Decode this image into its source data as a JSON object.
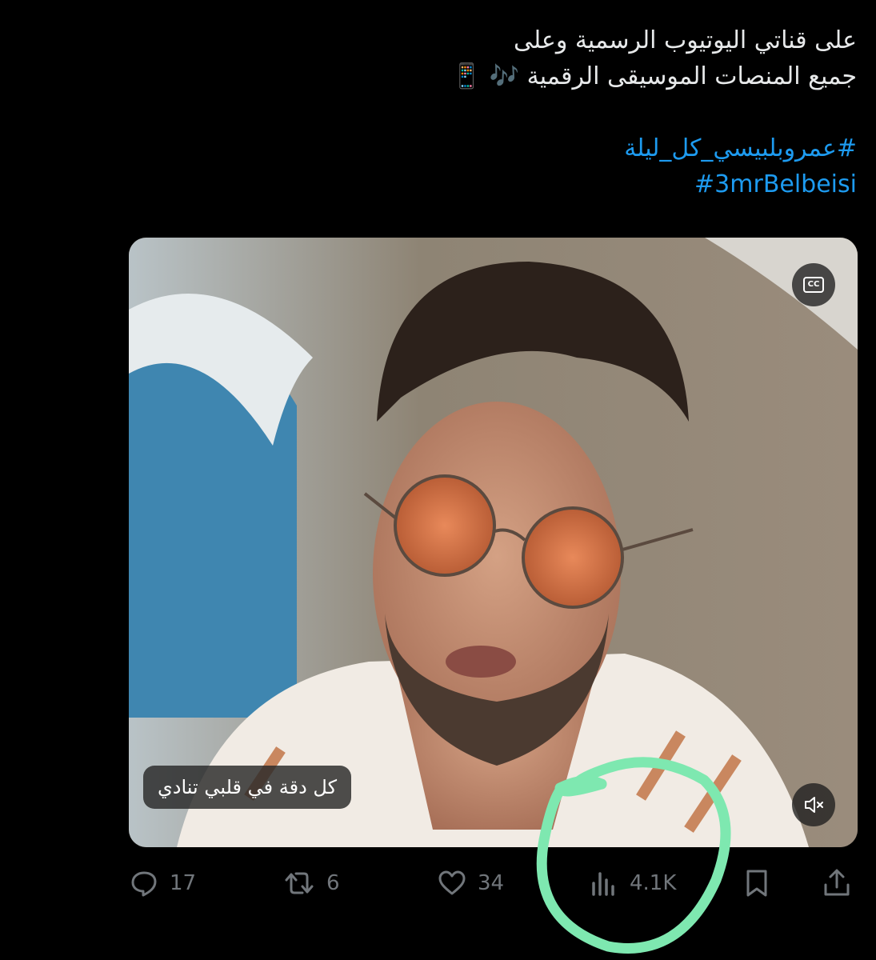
{
  "tweet": {
    "line1": "على قناتي اليوتيوب الرسمية وعلى",
    "line2": "جميع المنصات الموسيقى الرقمية 🎶 📱",
    "hashtag_arabic": "#عمروبلبيسي_كل_ليلة",
    "hashtag_latin": "#3mrBelbeisi"
  },
  "media": {
    "cc_label": "CC",
    "subtitle": "كل دقة في قلبي تنادي"
  },
  "actions": {
    "replies": "17",
    "reposts": "6",
    "likes": "34",
    "views": "4.1K"
  },
  "colors": {
    "background": "#000000",
    "text": "#e7e9ea",
    "link": "#1d9bf0",
    "icon_gray": "#71767b",
    "annotation_green": "#7ee8b0"
  },
  "icons": [
    "cc-icon",
    "mute-icon",
    "reply-icon",
    "repost-icon",
    "like-icon",
    "views-icon",
    "bookmark-icon",
    "share-icon"
  ]
}
